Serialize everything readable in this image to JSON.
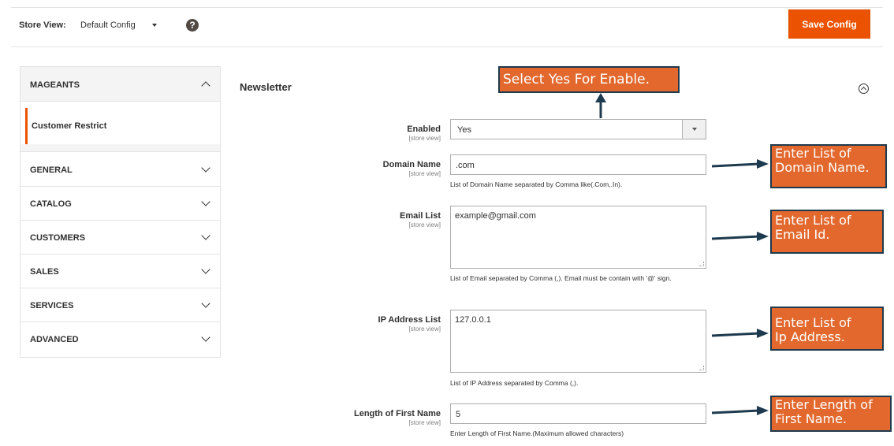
{
  "toolbar": {
    "store_view_label": "Store View:",
    "store_view_value": "Default Config",
    "help_icon": "question-circle-icon",
    "save_label": "Save Config",
    "save_color": "#eb5202"
  },
  "sidebar": {
    "group": "MAGEANTS",
    "active_item": "Customer Restrict",
    "sections": [
      "GENERAL",
      "CATALOG",
      "CUSTOMERS",
      "SALES",
      "SERVICES",
      "ADVANCED"
    ]
  },
  "main": {
    "section_title": "Newsletter",
    "scope": "[store view]",
    "fields": {
      "enabled": {
        "label": "Enabled",
        "value": "Yes"
      },
      "domain": {
        "label": "Domain Name",
        "value": ".com",
        "note": "List of Domain Name separated by Comma like(.Com,.In)."
      },
      "email": {
        "label": "Email List",
        "value": "example@gmail.com",
        "note": "List of Email separated by Comma (,). Email must be contain with '@' sign."
      },
      "ip": {
        "label": "IP Address List",
        "value": "127.0.0.1",
        "note": "List of IP Address separated by Comma (,)."
      },
      "firstname": {
        "label": "Length of First Name",
        "value": "5",
        "note": "Enter Length of First Name.(Maximum allowed characters)"
      }
    }
  },
  "callouts": {
    "enable": "Select Yes For Enable.",
    "domain_1": "Enter List of",
    "domain_2": "Domain Name.",
    "email_1": "Enter List of",
    "email_2": "Email Id.",
    "ip_1": "Enter List of",
    "ip_2": "Ip Address.",
    "first_1": "Enter Length of",
    "first_2": "First Name.",
    "callout_color": "#e2682d",
    "border_color": "#1e3a4e"
  }
}
